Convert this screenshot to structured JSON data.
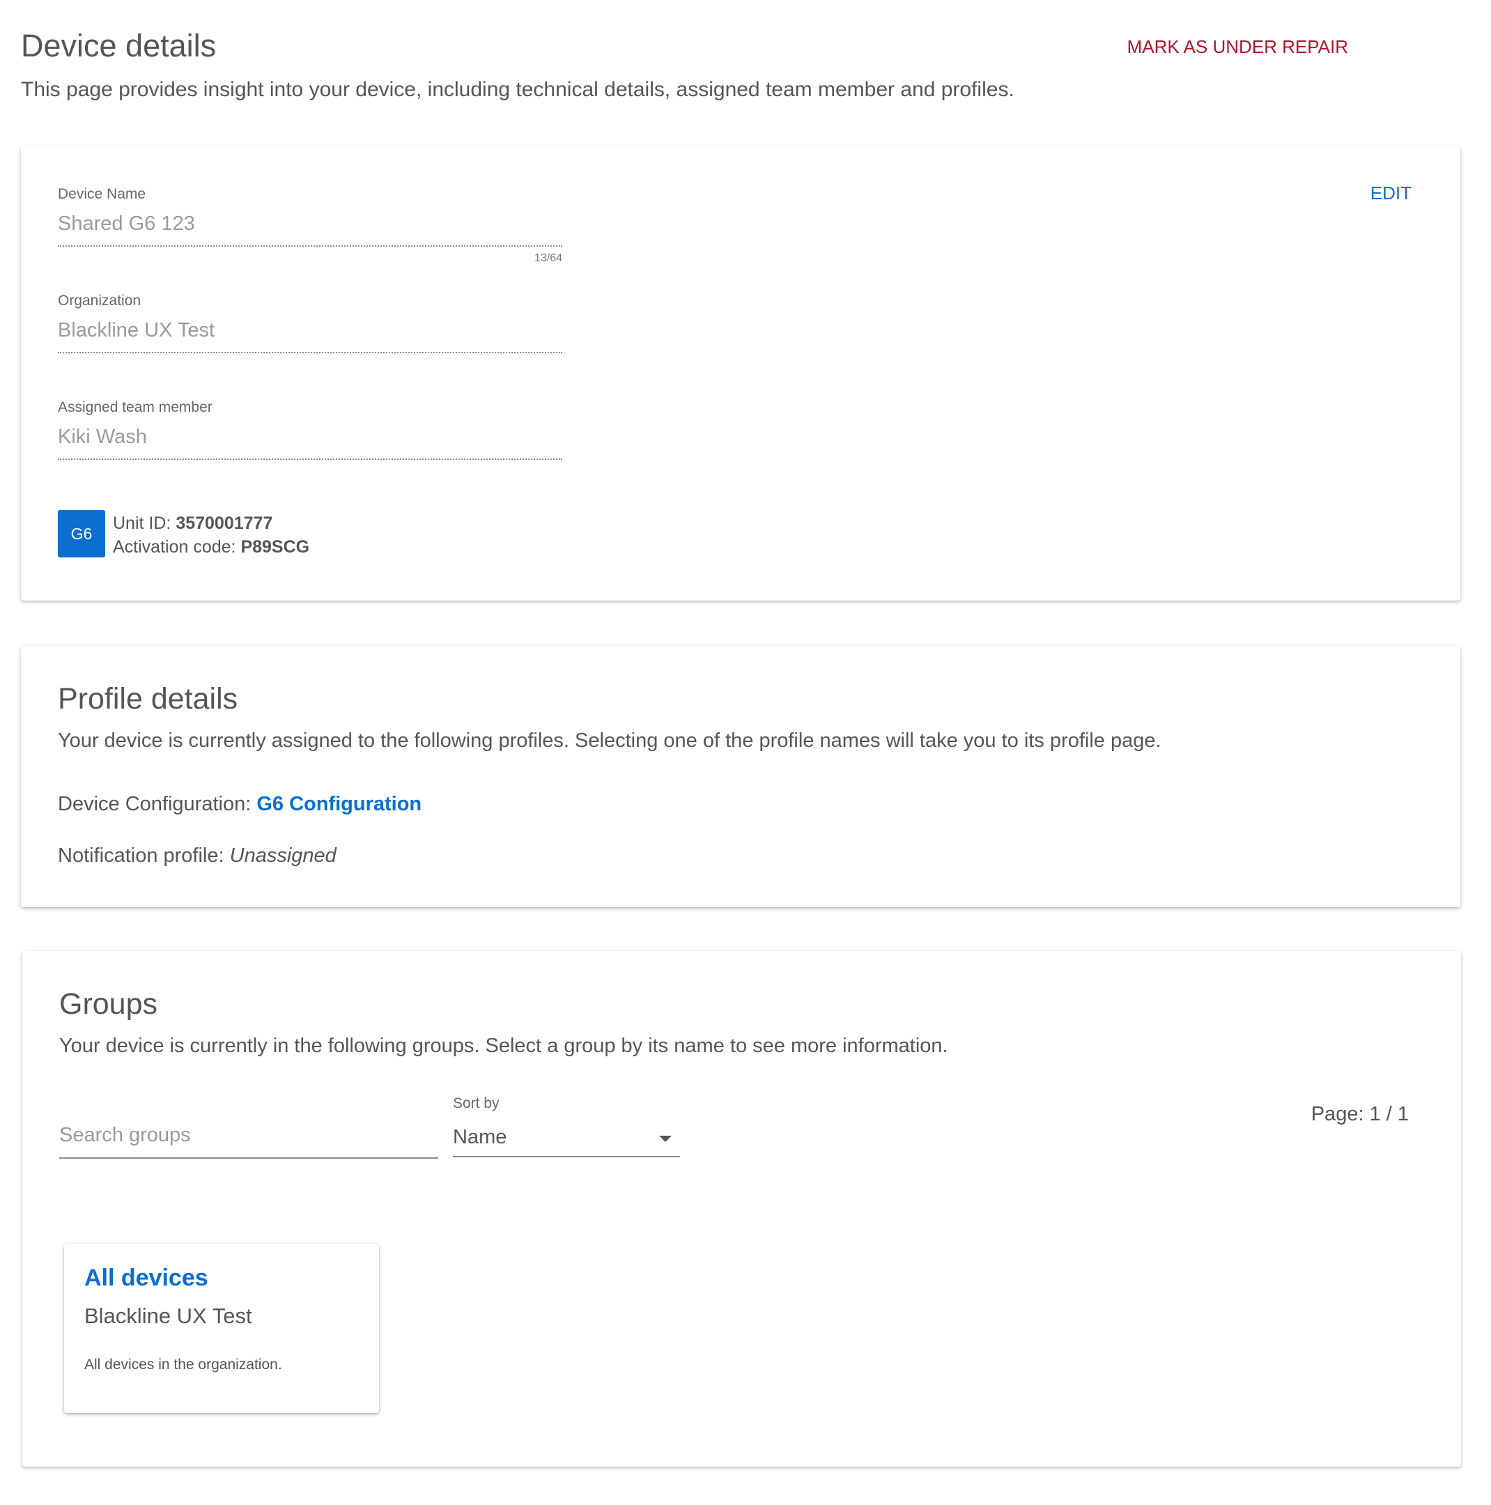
{
  "header": {
    "title": "Device details",
    "subtitle": "This page provides insight into your device, including technical details, assigned team member and profiles.",
    "repair_label": "MARK AS UNDER REPAIR"
  },
  "device": {
    "edit_label": "EDIT",
    "name_label": "Device Name",
    "name_value": "Shared G6 123",
    "name_counter": "13/64",
    "org_label": "Organization",
    "org_value": "Blackline UX Test",
    "member_label": "Assigned team member",
    "member_value": "Kiki Wash",
    "badge": "G6",
    "unit_id_label": "Unit ID:",
    "unit_id_value": "3570001777",
    "activation_label": "Activation code:",
    "activation_value": "P89SCG"
  },
  "profile": {
    "title": "Profile details",
    "description": "Your device is currently assigned to the following profiles. Selecting one of the profile names will take you to its profile page.",
    "config_label": "Device Configuration:",
    "config_value": "G6 Configuration",
    "notification_label": "Notification profile:",
    "notification_value": "Unassigned"
  },
  "groups": {
    "title": "Groups",
    "description": "Your device is currently in the following groups. Select a group by its name to see more information.",
    "search_placeholder": "Search groups",
    "sort_label": "Sort by",
    "sort_value": "Name",
    "page_indicator": "Page: 1 / 1",
    "items": [
      {
        "name": "All devices",
        "org": "Blackline UX Test",
        "description": "All devices in the organization."
      }
    ]
  },
  "colors": {
    "accent": "#0a6fd0",
    "danger": "#b0152d",
    "text": "#555555"
  }
}
